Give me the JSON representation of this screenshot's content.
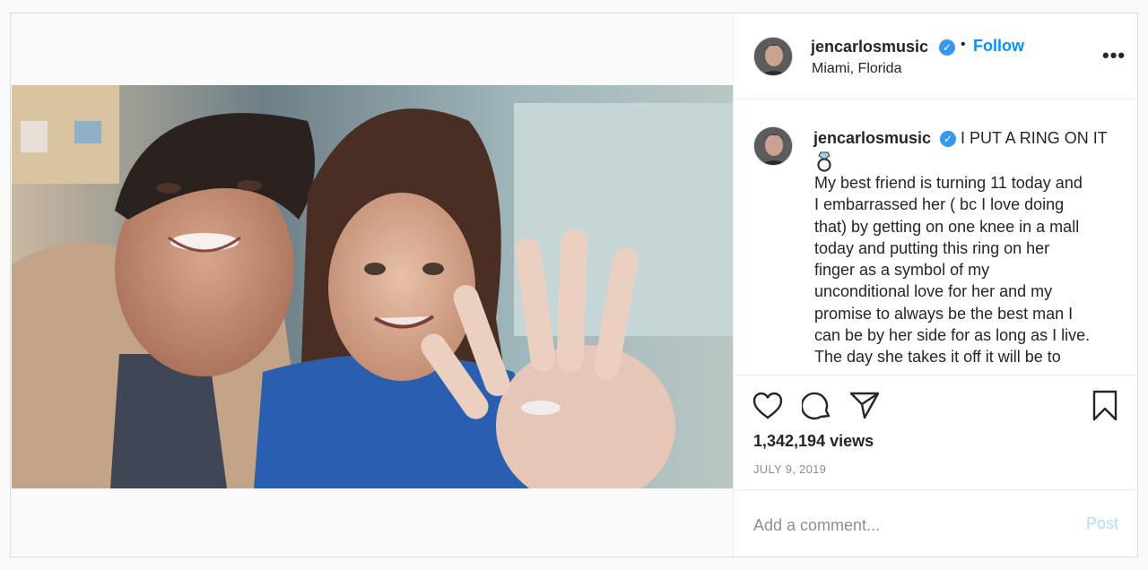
{
  "post": {
    "author": {
      "username": "jencarlosmusic",
      "verified_icon": "verified-badge-icon",
      "location": "Miami, Florida"
    },
    "follow_label": "Follow",
    "more_icon": "more-options-icon",
    "more_label": "•••",
    "caption": {
      "username": "jencarlosmusic",
      "title": "I PUT A RING ON IT",
      "emoji_icon": "ring-emoji-icon",
      "lines": [
        "My best friend is turning 11 today and",
        "I embarrassed her ( bc I love doing",
        "that) by getting on one knee in a mall",
        "today and putting this ring on her",
        "finger as a symbol of my",
        "unconditional love for her and my",
        "promise to always be the best man I",
        "can be by her side for as long as I live.",
        "The day she takes it off it will be to"
      ]
    },
    "actions": {
      "like_icon": "heart-icon",
      "comment_icon": "comment-bubble-icon",
      "share_icon": "paper-plane-icon",
      "save_icon": "bookmark-icon"
    },
    "views": "1,342,194 views",
    "date": "JULY 9, 2019",
    "comment": {
      "placeholder": "Add a comment...",
      "post_label": "Post"
    },
    "media": {
      "type": "video",
      "description_icon": "video-player"
    }
  },
  "colors": {
    "accent": "#0095f6",
    "verified": "#3897f0",
    "post_disabled": "#b3dbff",
    "muted": "#8e8e8e",
    "border": "#dbdbdb"
  }
}
